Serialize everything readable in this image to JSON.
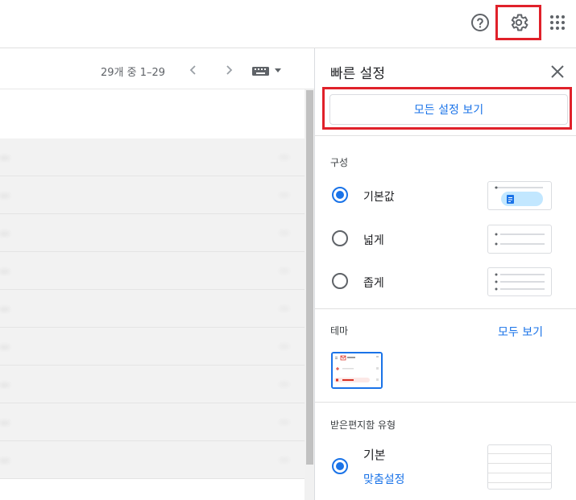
{
  "topbar": {
    "help_icon": "help-circle-icon",
    "settings_icon": "gear-icon",
    "apps_icon": "apps-grid-icon"
  },
  "toolbar": {
    "count": "29개 중 1–29",
    "prev_icon": "chevron-left-icon",
    "next_icon": "chevron-right-icon",
    "keyboard_icon": "keyboard-icon"
  },
  "mail_rows": [
    {
      "text": "...",
      "date": "..."
    },
    {
      "text": "...",
      "date": "..."
    },
    {
      "text": "...",
      "date": "..."
    },
    {
      "text": "...",
      "date": "..."
    },
    {
      "text": "...",
      "date": "..."
    },
    {
      "text": "...",
      "date": "..."
    },
    {
      "text": "...",
      "date": "..."
    },
    {
      "text": "...",
      "date": "..."
    },
    {
      "text": "...",
      "date": "..."
    },
    {
      "text": "...",
      "date": "..."
    }
  ],
  "quick_settings": {
    "title": "빠른 설정",
    "all_settings_button": "모든 설정 보기",
    "density": {
      "label": "구성",
      "options": [
        "기본값",
        "넓게",
        "좁게"
      ],
      "selected": "기본값"
    },
    "theme": {
      "label": "테마",
      "see_all": "모두 보기"
    },
    "inbox_type": {
      "label": "받은편지함 유형",
      "option": "기본",
      "customize": "맞춤설정"
    }
  },
  "colors": {
    "accent": "#1a73e8",
    "highlight": "#e0212a"
  }
}
